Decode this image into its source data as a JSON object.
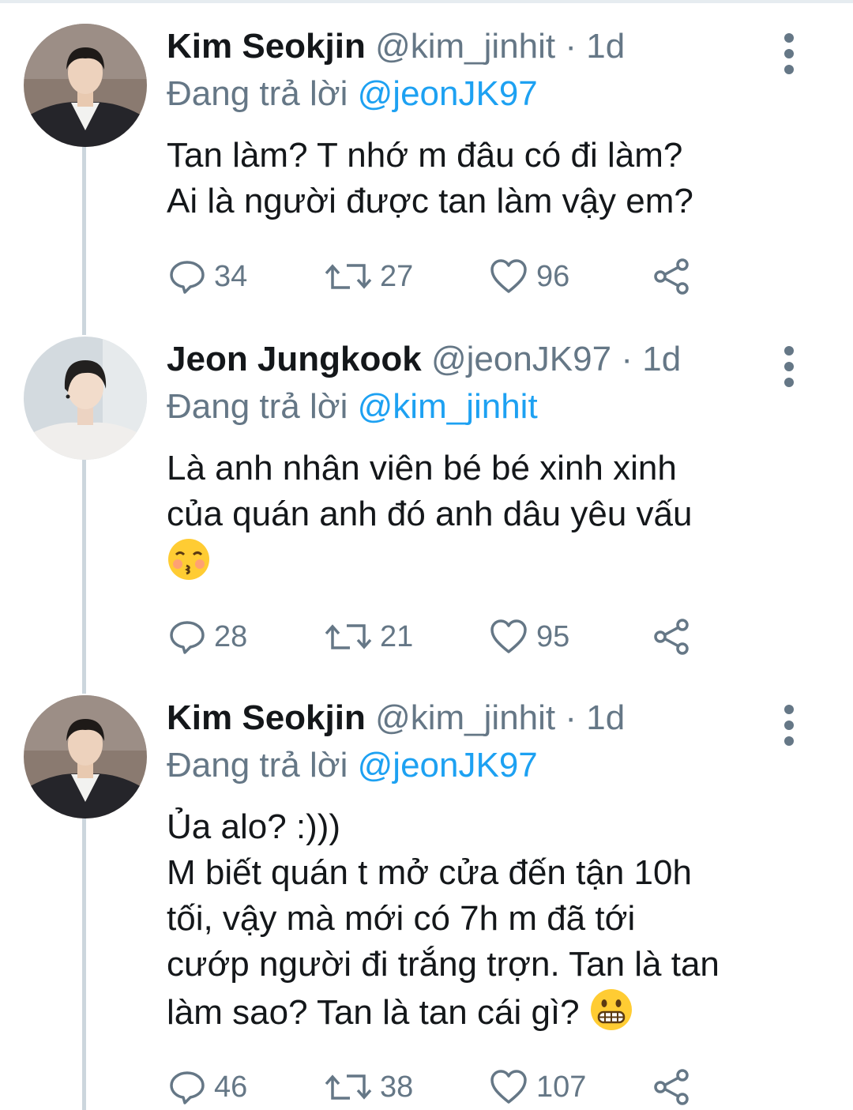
{
  "tweets": [
    {
      "name": "Kim Seokjin",
      "handle": "@kim_jinhit",
      "dot": "·",
      "time": "1d",
      "reply_prefix": "Đang trả lời",
      "reply_to": "@jeonJK97",
      "lines": [
        "Tan làm? T nhớ m đâu có đi làm?",
        "Ai là người được tan làm vậy em?"
      ],
      "reply_count": "34",
      "retweet_count": "27",
      "like_count": "96"
    },
    {
      "name": "Jeon Jungkook",
      "handle": "@jeonJK97",
      "dot": "·",
      "time": "1d",
      "reply_prefix": "Đang trả lời",
      "reply_to": "@kim_jinhit",
      "lines": [
        "Là anh nhân viên bé bé xinh xinh",
        "của quán anh đó anh dâu yêu vấu"
      ],
      "emoji": "kissing-face-emoji",
      "reply_count": "28",
      "retweet_count": "21",
      "like_count": "95"
    },
    {
      "name": "Kim Seokjin",
      "handle": "@kim_jinhit",
      "dot": "·",
      "time": "1d",
      "reply_prefix": "Đang trả lời",
      "reply_to": "@jeonJK97",
      "lines": [
        "Ủa alo? :)))",
        "M biết quán t mở cửa đến tận 10h",
        "tối, vậy mà mới có 7h m đã tới",
        "cướp người đi trắng trợn. Tan là tan",
        "làm sao? Tan là tan cái gì?"
      ],
      "emoji": "grimacing-face-emoji",
      "reply_count": "46",
      "retweet_count": "38",
      "like_count": "107"
    }
  ],
  "colors": {
    "text": "#14171a",
    "secondary": "#657786",
    "link": "#1da1f2",
    "thread": "#ccd6dd"
  }
}
